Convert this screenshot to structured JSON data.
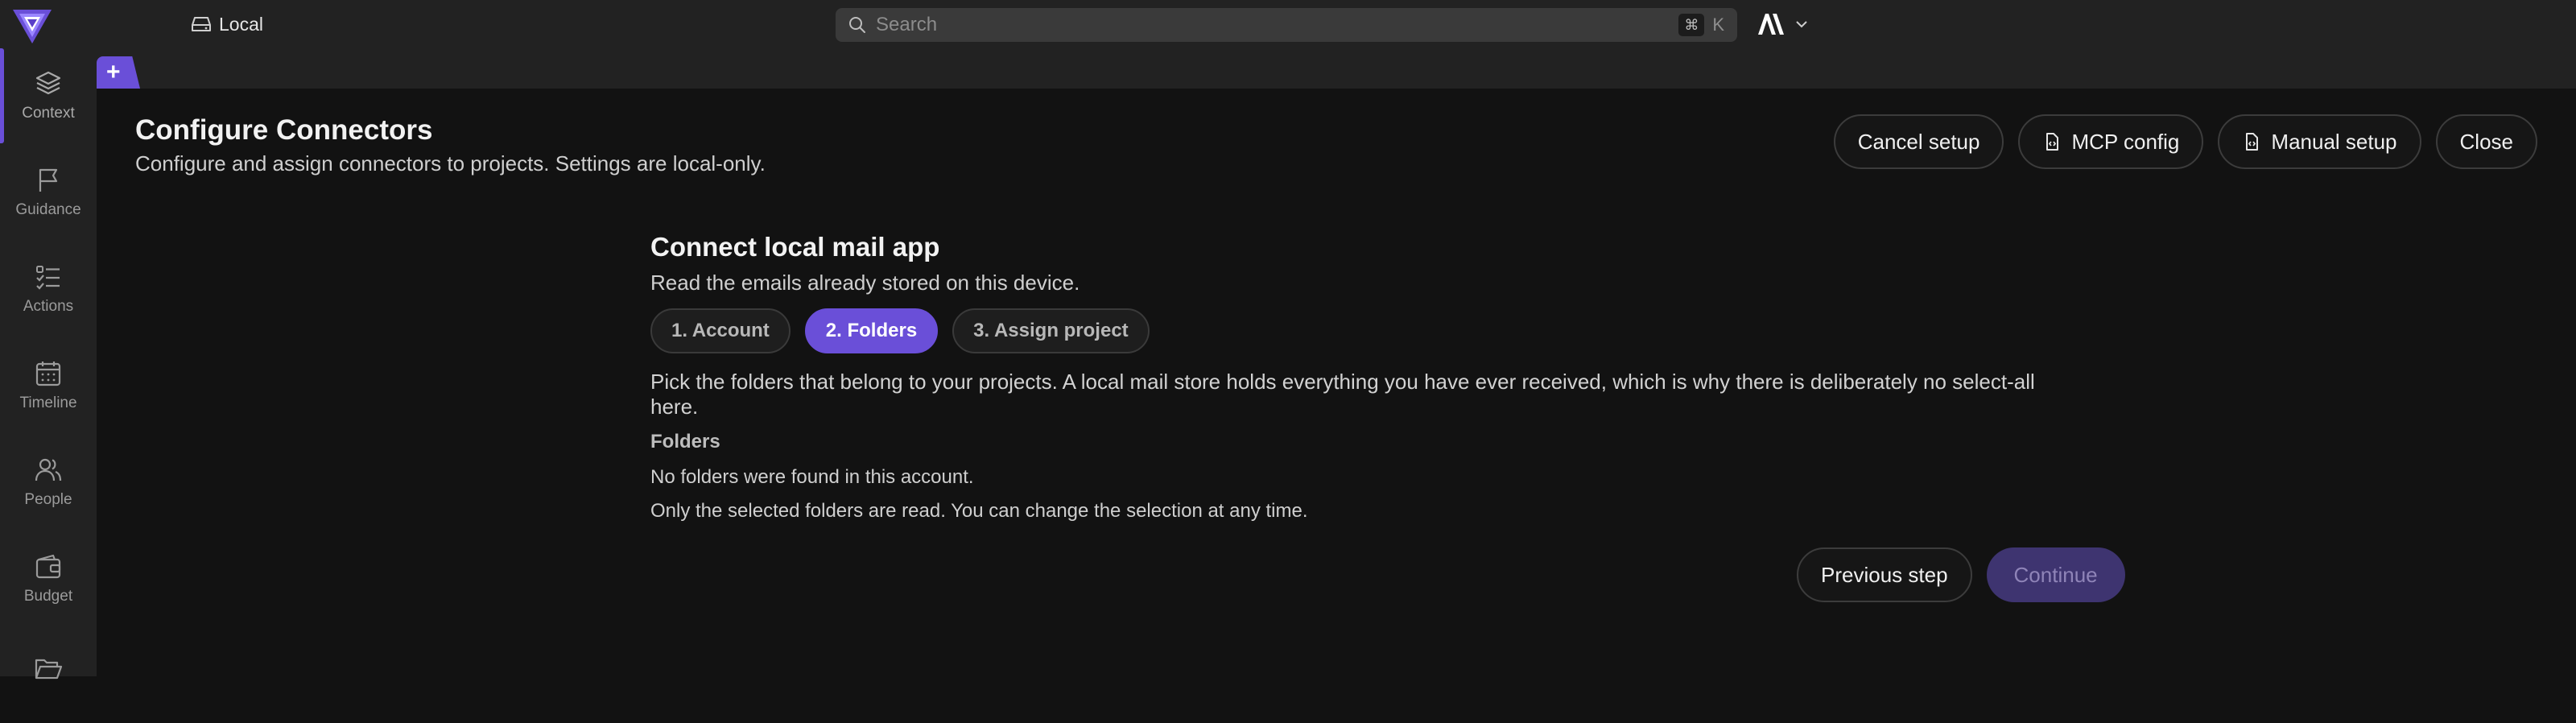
{
  "topbar": {
    "location_label": "Local",
    "search_placeholder": "Search",
    "shortcut_modifier": "⌘",
    "shortcut_key": "K"
  },
  "tabs": {
    "new_tab_symbol": "+"
  },
  "sidebar": {
    "items": [
      {
        "label": "Context",
        "icon": "layers-icon",
        "active": true
      },
      {
        "label": "Guidance",
        "icon": "flag-icon",
        "active": false
      },
      {
        "label": "Actions",
        "icon": "checklist-icon",
        "active": false
      },
      {
        "label": "Timeline",
        "icon": "calendar-icon",
        "active": false
      },
      {
        "label": "People",
        "icon": "people-icon",
        "active": false
      },
      {
        "label": "Budget",
        "icon": "wallet-icon",
        "active": false
      },
      {
        "label": "",
        "icon": "folder-icon",
        "active": false
      }
    ]
  },
  "header": {
    "title": "Configure Connectors",
    "subtitle": "Configure and assign connectors to projects. Settings are local-only.",
    "buttons": {
      "cancel": "Cancel setup",
      "mcp": "MCP config",
      "manual": "Manual setup",
      "close": "Close"
    }
  },
  "wizard": {
    "title": "Connect local mail app",
    "subtitle": "Read the emails already stored on this device.",
    "steps": [
      "1. Account",
      "2. Folders",
      "3. Assign project"
    ],
    "active_step": 1,
    "description": "Pick the folders that belong to your projects. A local mail store holds everything you have ever received, which is why there is deliberately no select-all here.",
    "folders_label": "Folders",
    "empty_message": "No folders were found in this account.",
    "hint": "Only the selected folders are read. You can change the selection at any time.",
    "previous_label": "Previous step",
    "continue_label": "Continue",
    "continue_enabled": false
  },
  "colors": {
    "accent": "#6a4fd8",
    "accent_disabled": "#3e3470",
    "background": "#121212",
    "chrome": "#222222"
  }
}
